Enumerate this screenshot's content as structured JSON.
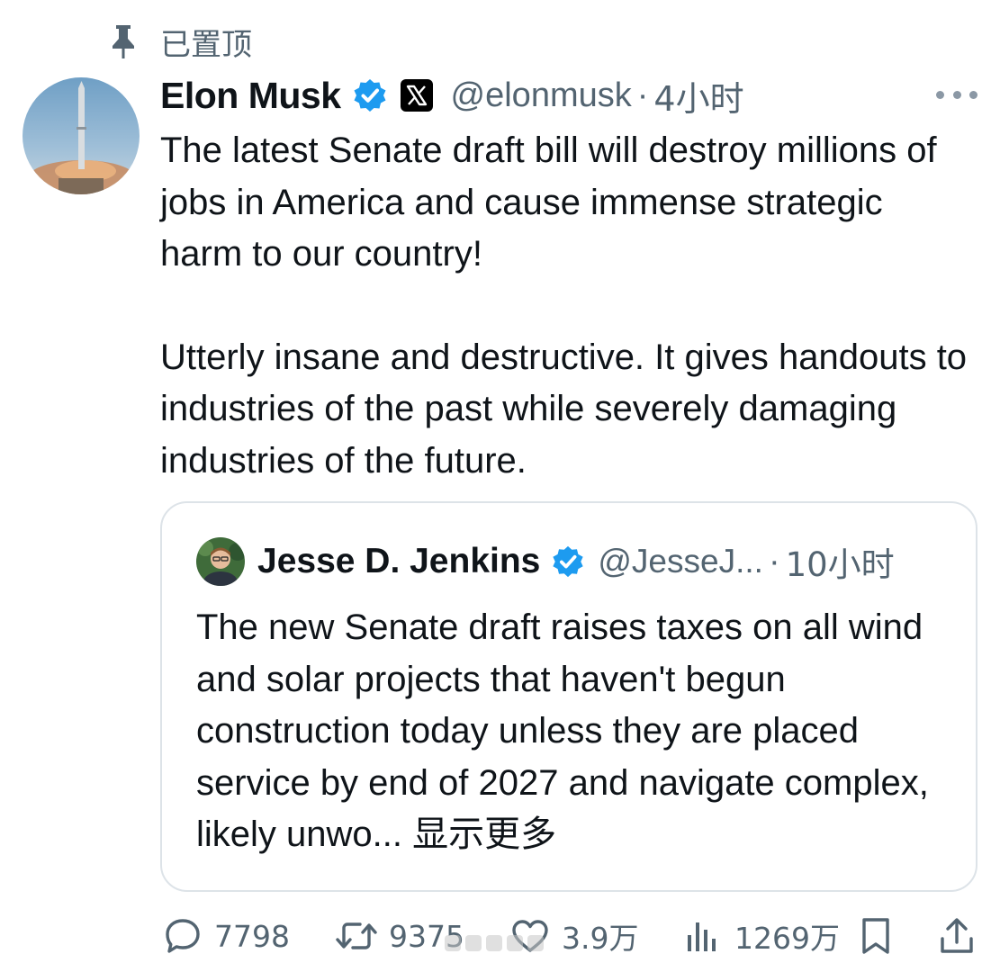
{
  "pinned": {
    "label": "已置顶"
  },
  "tweet": {
    "author_name": "Elon Musk",
    "handle": "@elonmusk",
    "separator": "·",
    "time": "4小时",
    "paragraphs": [
      "The latest Senate draft bill will destroy millions of jobs in America and cause immense strategic harm to our country!",
      "Utterly insane and destructive. It gives handouts to industries of the past while severely damaging industries of the future."
    ]
  },
  "quote": {
    "author_name": "Jesse D. Jenkins",
    "handle": "@JesseJ...",
    "separator": "·",
    "time": "10小时",
    "text": "The new Senate draft raises taxes on all wind and solar projects that haven't begun construction today unless they are placed service by end of 2027 and navigate complex, likely unwo...",
    "show_more": "显示更多"
  },
  "actions": {
    "replies": "7798",
    "reposts": "9375",
    "likes": "3.9万",
    "views": "1269万"
  },
  "icons": {
    "pin": "pin-icon",
    "verified": "verified-badge-icon",
    "x_logo": "x-logo-icon",
    "more": "more-icon",
    "reply": "reply-icon",
    "repost": "repost-icon",
    "like": "heart-icon",
    "views": "views-icon",
    "bookmark": "bookmark-icon",
    "share": "share-icon"
  },
  "colors": {
    "verified_blue": "#1d9bf0",
    "secondary_text": "#536471",
    "primary_text": "#0f1419",
    "border": "#dde3e8"
  }
}
